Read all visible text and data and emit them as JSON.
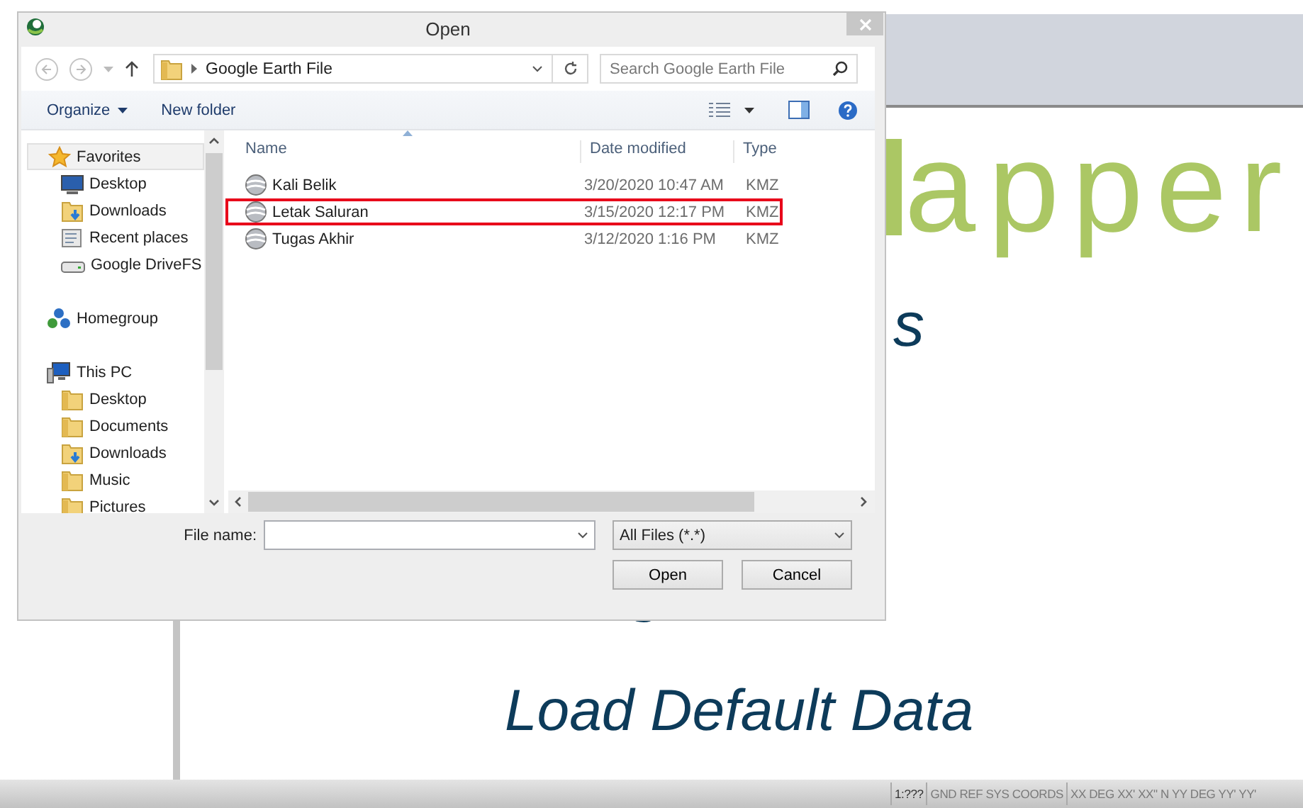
{
  "dialog": {
    "title": "Open",
    "address": {
      "path": "Google Earth File"
    },
    "search": {
      "placeholder": "Search Google Earth File"
    },
    "toolbar": {
      "organize": "Organize",
      "new_folder": "New folder"
    },
    "navigation": [
      {
        "label": "Favorites",
        "kind": "star",
        "selected": true,
        "children": [
          {
            "label": "Desktop",
            "kind": "desktop",
            "selected": false
          },
          {
            "label": "Downloads",
            "kind": "downloads",
            "selected": false
          },
          {
            "label": "Recent places",
            "kind": "recent",
            "selected": false
          },
          {
            "label": "Google DriveFS",
            "kind": "drive",
            "selected": false
          }
        ]
      },
      {
        "label": "Homegroup",
        "kind": "network",
        "selected": false
      },
      {
        "label": "This PC",
        "kind": "computer",
        "selected": false,
        "children": [
          {
            "label": "Desktop",
            "kind": "folder",
            "selected": false
          },
          {
            "label": "Documents",
            "kind": "folder",
            "selected": false
          },
          {
            "label": "Downloads",
            "kind": "downloads",
            "selected": false
          },
          {
            "label": "Music",
            "kind": "folder",
            "selected": false
          },
          {
            "label": "Pictures",
            "kind": "folder",
            "selected": false
          }
        ]
      }
    ],
    "columns": [
      "Name",
      "Date modified",
      "Type"
    ],
    "files": [
      {
        "name": "Kali Belik",
        "date": "3/20/2020 10:47 AM",
        "type": "KMZ",
        "highlighted": false
      },
      {
        "name": "Letak Saluran",
        "date": "3/15/2020 12:17 PM",
        "type": "KMZ",
        "highlighted": true
      },
      {
        "name": "Tugas Akhir",
        "date": "3/12/2020 1:16 PM",
        "type": "KMZ",
        "highlighted": false
      }
    ],
    "file_name": {
      "label": "File name:"
    },
    "filter": {
      "value": "All Files (*.*)"
    },
    "buttons": [
      "Open",
      "Cancel"
    ]
  },
  "background": {
    "title_fragment": "apper",
    "subtitle_fragment": "s",
    "action": "Load Default Data"
  },
  "status_bar": [
    "1:???",
    "GND REF SYS COORDS",
    "XX DEG XX' XX\" N YY DEG YY' YY'"
  ]
}
